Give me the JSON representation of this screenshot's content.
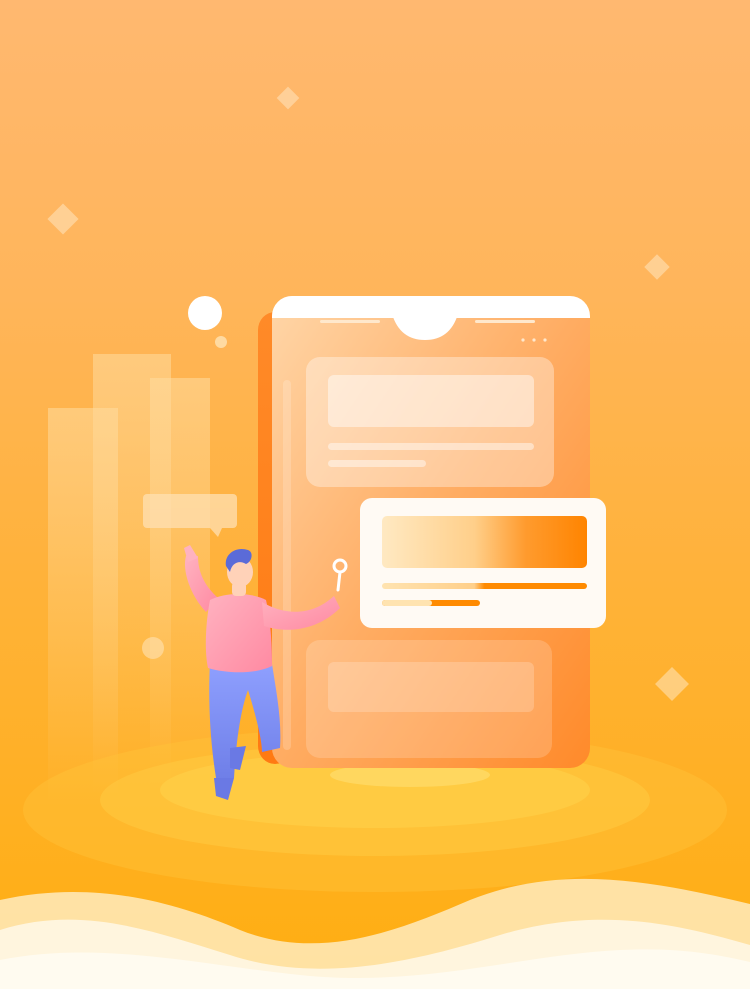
{
  "scene": {
    "description_free": true
  },
  "colors": {
    "bg_top": "#ffb870",
    "bg_bottom": "#ffae10",
    "phone_body": "#ff9a3c",
    "phone_side": "#ff7d10",
    "card_white": "#fffaf4",
    "accent_orange": "#ff8a00",
    "shirt_pink": "#ff9db0",
    "pants_blue": "#7d8ef5",
    "wave_light": "#fff1cf"
  },
  "icons": {
    "decor": [
      "diamond-icon",
      "circle-icon",
      "key-icon",
      "speech-bubble-icon"
    ]
  }
}
